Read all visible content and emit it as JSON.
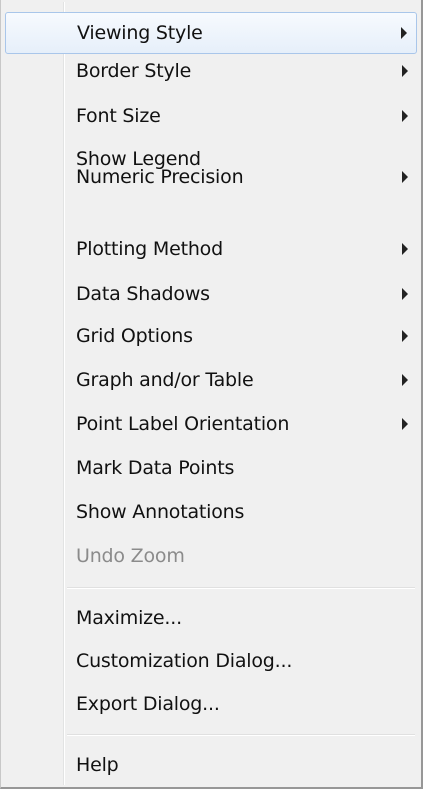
{
  "menu": {
    "items": [
      {
        "label": "Viewing Style",
        "submenu": true
      },
      {
        "label": "Border Style",
        "submenu": true
      },
      {
        "label": "Font Size",
        "submenu": true
      },
      {
        "label": "Show Legend",
        "submenu": false
      },
      {
        "label": "Numeric Precision",
        "submenu": true
      },
      {
        "label": "Plotting Method",
        "submenu": true
      },
      {
        "label": "Data Shadows",
        "submenu": true
      },
      {
        "label": "Grid Options",
        "submenu": true
      },
      {
        "label": "Graph and/or Table",
        "submenu": true
      },
      {
        "label": "Point Label Orientation",
        "submenu": true
      },
      {
        "label": "Mark Data Points",
        "submenu": false
      },
      {
        "label": "Show Annotations",
        "submenu": false
      },
      {
        "label": "Undo Zoom",
        "submenu": false,
        "disabled": true
      },
      {
        "label": "Maximize...",
        "submenu": false
      },
      {
        "label": "Customization Dialog...",
        "submenu": false
      },
      {
        "label": "Export Dialog...",
        "submenu": false
      },
      {
        "label": "Help",
        "submenu": false
      }
    ],
    "highlighted_item": "Viewing Style",
    "colors": {
      "background": "#f0f0f0",
      "highlight_border": "#a9c6ea",
      "disabled_text": "#8b8b8b"
    }
  }
}
